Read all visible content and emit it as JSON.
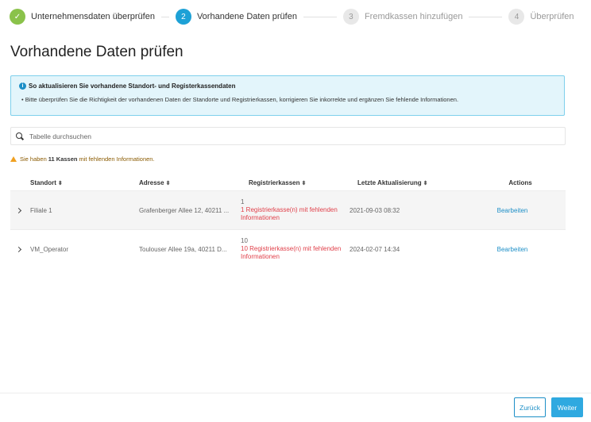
{
  "stepper": {
    "steps": [
      {
        "number": "✓",
        "label": "Unternehmensdaten überprüfen",
        "state": "done"
      },
      {
        "number": "2",
        "label": "Vorhandene Daten prüfen",
        "state": "active"
      },
      {
        "number": "3",
        "label": "Fremdkassen hinzufügen",
        "state": "pending"
      },
      {
        "number": "4",
        "label": "Überprüfen",
        "state": "pending"
      }
    ]
  },
  "page": {
    "title": "Vorhandene Daten prüfen"
  },
  "info": {
    "title": "So aktualisieren Sie vorhandene Standort- und Registerkassendaten",
    "text": "• Bitte überprüfen Sie die Richtigkeit der vorhandenen Daten der Standorte und Registrierkassen, korrigieren Sie inkorrekte und ergänzen Sie fehlende Informationen."
  },
  "search": {
    "placeholder": "Tabelle durchsuchen"
  },
  "warning": {
    "prefix": "Sie haben",
    "count": "11 Kassen",
    "suffix": "mit fehlenden Informationen."
  },
  "table": {
    "headers": {
      "standort": "Standort",
      "adresse": "Adresse",
      "kassen": "Registrierkassen",
      "aktualisierung": "Letzte Aktualisierung",
      "actions": "Actions"
    },
    "sort_glyph": "⬍",
    "rows": [
      {
        "standort": "Filiale 1",
        "adresse": "Grafenberger Allee 12, 40211 ...",
        "kassen_count": "1",
        "kassen_missing": "1 Registrierkasse(n) mit fehlenden Informationen",
        "aktualisierung": "2021-09-03 08:32",
        "action": "Bearbeiten"
      },
      {
        "standort": "VM_Operator",
        "adresse": "Toulouser Allee 19a, 40211 D...",
        "kassen_count": "10",
        "kassen_missing": "10 Registrierkasse(n) mit fehlenden Informationen",
        "aktualisierung": "2024-02-07 14:34",
        "action": "Bearbeiten"
      }
    ]
  },
  "footer": {
    "back_label": "Zurück",
    "next_label": "Weiter"
  }
}
